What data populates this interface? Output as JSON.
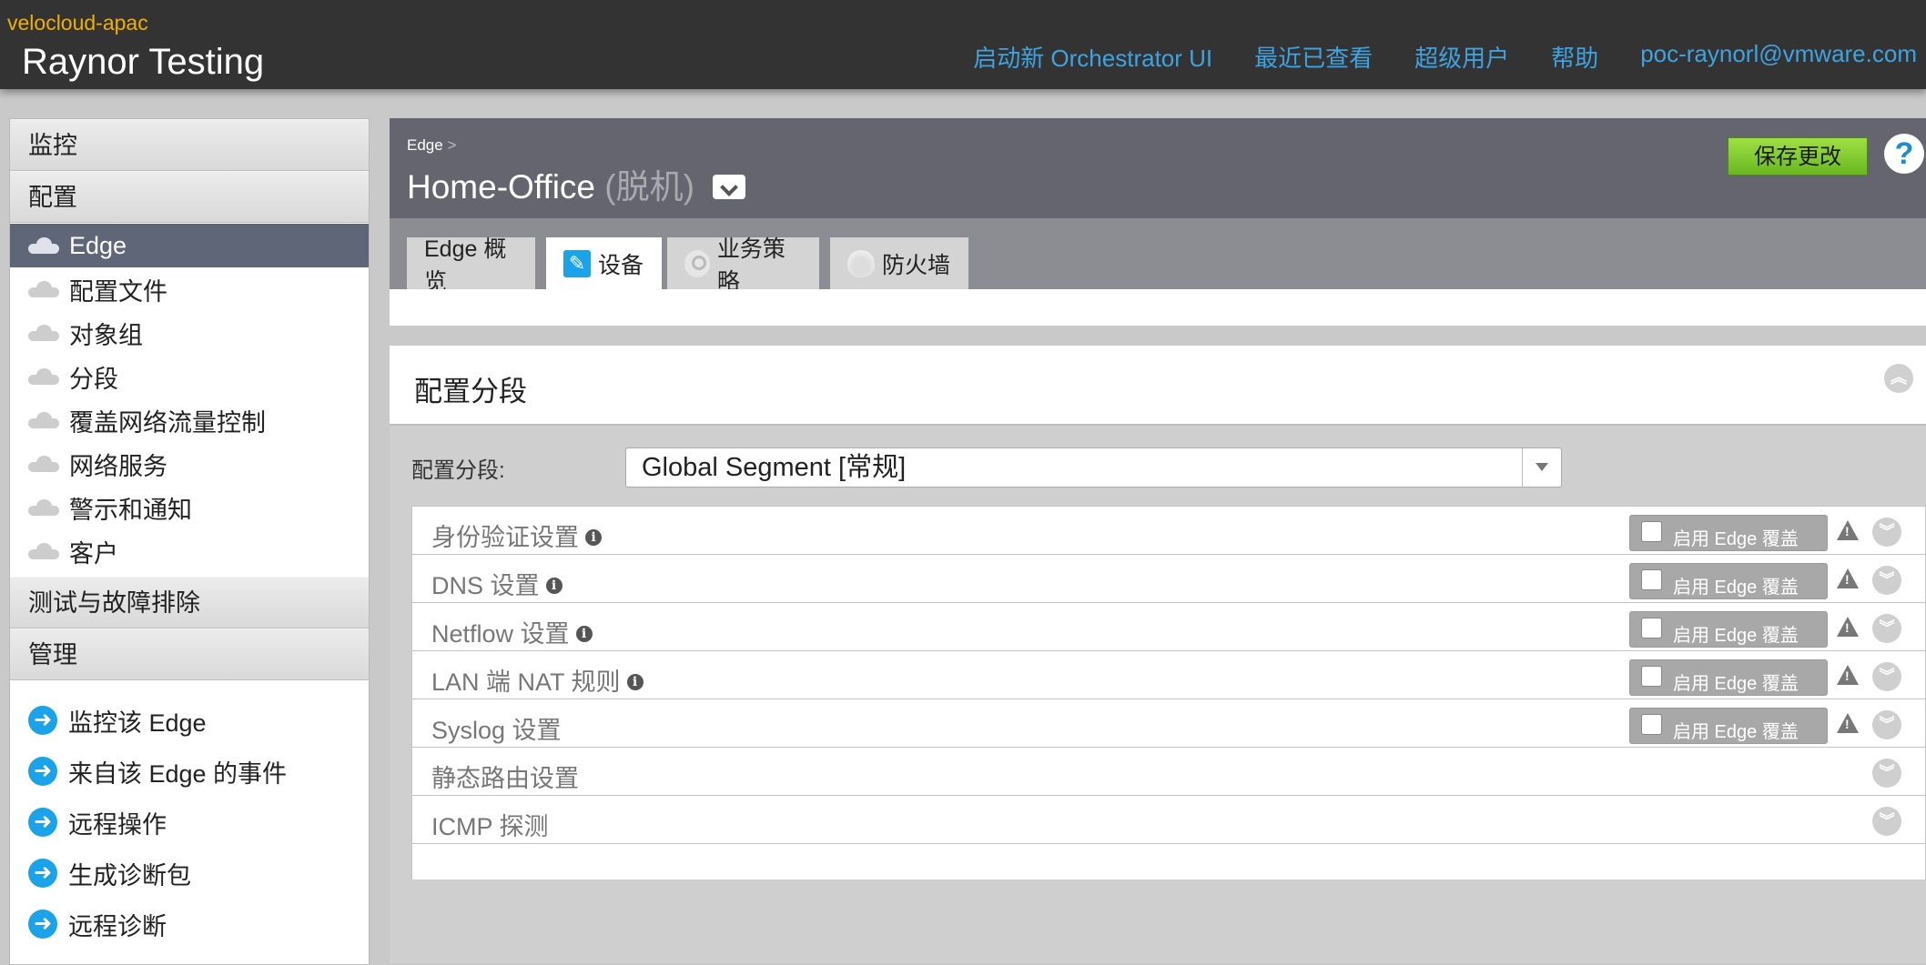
{
  "header": {
    "org": "velocloud-apac",
    "title": "Raynor Testing",
    "nav": [
      "启动新 Orchestrator UI",
      "最近已查看",
      "超级用户",
      "帮助",
      "poc-raynorl@vmware.com"
    ]
  },
  "sidebar": {
    "monitor": "监控",
    "configure": "配置",
    "configure_items": [
      "Edge",
      "配置文件",
      "对象组",
      "分段",
      "覆盖网络流量控制",
      "网络服务",
      "警示和通知",
      "客户"
    ],
    "test": "测试与故障排除",
    "manage": "管理",
    "manage_items": [
      "监控该 Edge",
      "来自该 Edge 的事件",
      "远程操作",
      "生成诊断包",
      "远程诊断"
    ]
  },
  "main": {
    "breadcrumb": "Edge",
    "breadcrumb_sep": ">",
    "edge_name": "Home-Office",
    "edge_status": "(脱机)",
    "save_label": "保存更改",
    "help_label": "?",
    "tabs": [
      "Edge 概览",
      "设备",
      "业务策略",
      "防火墙"
    ],
    "active_tab": "设备"
  },
  "panel": {
    "title": "配置分段",
    "segment_label": "配置分段:",
    "segment_value": "Global Segment [常规]",
    "override_label": "启用 Edge 覆盖",
    "sections": [
      "身份验证设置",
      "DNS 设置",
      "Netflow 设置",
      "LAN 端 NAT 规则",
      "Syslog 设置",
      "静态路由设置",
      "ICMP 探测"
    ]
  },
  "colors": {
    "accent": "#3ea3e0",
    "org": "#f0b000",
    "save": "#7ac52a",
    "sidebar_active": "#5f6677"
  }
}
